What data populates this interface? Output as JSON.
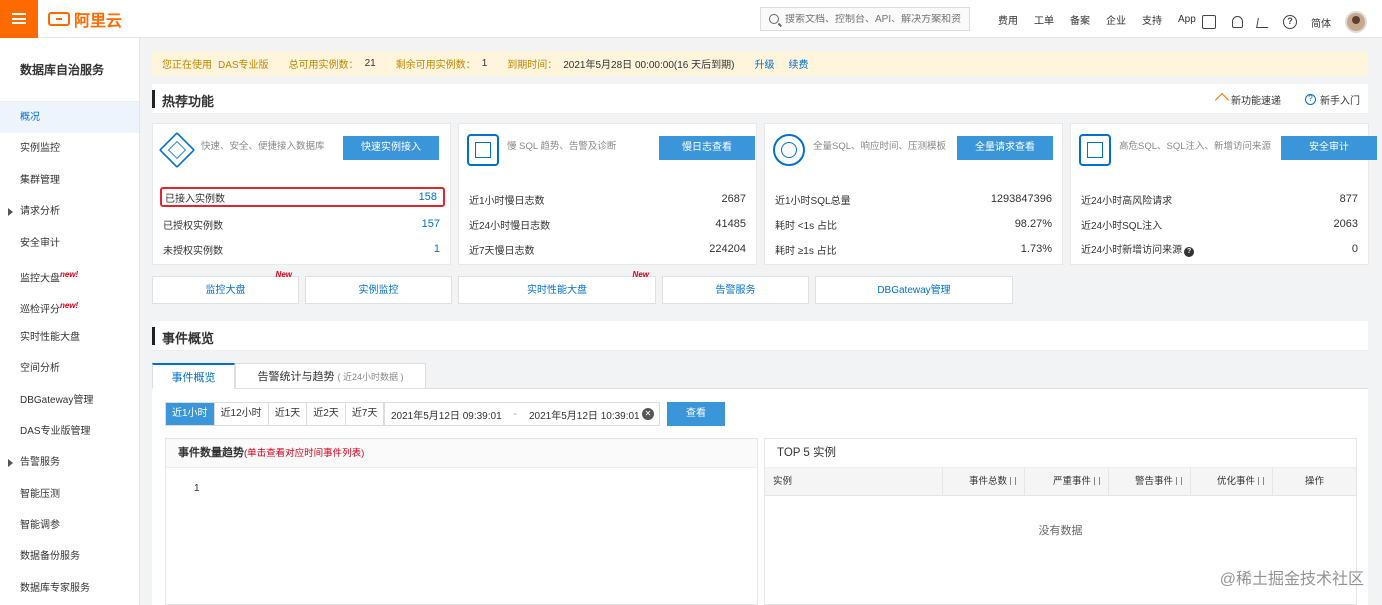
{
  "topbar": {
    "logo_text": "阿里云",
    "search_placeholder": "搜索文档、控制台、API、解决方案和资",
    "nav": [
      "费用",
      "工单",
      "备案",
      "企业",
      "支持",
      "App"
    ],
    "lang": "简体"
  },
  "sidebar": {
    "title": "数据库自治服务",
    "items": [
      {
        "label": "概况",
        "active": true
      },
      {
        "label": "实例监控"
      },
      {
        "label": "集群管理"
      },
      {
        "label": "请求分析",
        "caret": true
      },
      {
        "label": "安全审计"
      },
      {
        "label": "监控大盘",
        "new": "new!"
      },
      {
        "label": "巡检评分",
        "new": "new!"
      },
      {
        "label": "实时性能大盘"
      },
      {
        "label": "空间分析"
      },
      {
        "label": "DBGateway管理"
      },
      {
        "label": "DAS专业版管理"
      },
      {
        "label": "告警服务",
        "caret": true
      },
      {
        "label": "智能压测"
      },
      {
        "label": "智能调参"
      },
      {
        "label": "数据备份服务"
      },
      {
        "label": "数据库专家服务"
      }
    ]
  },
  "banner": {
    "using_label": "您正在使用",
    "using_value": "DAS专业版",
    "total_label": "总可用实例数：",
    "total_value": "21",
    "remain_label": "剩余可用实例数：",
    "remain_value": "1",
    "expire_label": "到期时间：",
    "expire_value": "2021年5月28日 00:00:00(16 天后到期)",
    "upgrade": "升级",
    "renew": "续费"
  },
  "hot": {
    "title": "热荐功能",
    "link_fast": "新功能速递",
    "link_guide": "新手入门"
  },
  "cards": [
    {
      "desc": "快速、安全、便捷接入数据库",
      "button": "快速实例接入",
      "rows": [
        {
          "label": "已接入实例数",
          "value": "158",
          "blue": true,
          "highlight": true
        },
        {
          "label": "已授权实例数",
          "value": "157",
          "blue": true
        },
        {
          "label": "未授权实例数",
          "value": "1",
          "blue": true
        }
      ]
    },
    {
      "desc": "慢 SQL 趋势、告警及诊断",
      "button": "慢日志查看",
      "rows": [
        {
          "label": "近1小时慢日志数",
          "value": "2687"
        },
        {
          "label": "近24小时慢日志数",
          "value": "41485"
        },
        {
          "label": "近7天慢日志数",
          "value": "224204"
        }
      ]
    },
    {
      "desc": "全量SQL、响应时间、压测模板",
      "button": "全量请求查看",
      "rows": [
        {
          "label": "近1小时SQL总量",
          "value": "1293847396"
        },
        {
          "label": "耗时 <1s 占比",
          "value": "98.27%"
        },
        {
          "label": "耗时 ≥1s 占比",
          "value": "1.73%"
        }
      ]
    },
    {
      "desc": "高危SQL、SQL注入、新增访问来源",
      "button": "安全审计",
      "rows": [
        {
          "label": "近24小时高风险请求",
          "value": "877"
        },
        {
          "label": "近24小时SQL注入",
          "value": "2063"
        },
        {
          "label": "近24小时新增访问来源",
          "value": "0",
          "help": true
        }
      ]
    }
  ],
  "quick_tabs": [
    {
      "label": "监控大盘",
      "new": "New"
    },
    {
      "label": "实例监控"
    },
    {
      "label": "实时性能大盘",
      "new": "New"
    },
    {
      "label": "告警服务"
    },
    {
      "label": "DBGateway管理"
    }
  ],
  "events": {
    "title": "事件概览",
    "tab_overview": "事件概览",
    "tab_alert": "告警统计与趋势",
    "tab_alert_note": "( 近24小时数据 )",
    "ranges": [
      "近1小时",
      "近12小时",
      "近1天",
      "近2天",
      "近7天"
    ],
    "date_start": "2021年5月12日 09:39:01",
    "date_sep": "-",
    "date_end": "2021年5月12日 10:39:01",
    "view_button": "查看",
    "trend_title": "事件数量趋势",
    "trend_hint": "(单击查看对应时间事件列表)",
    "trend_axis_value": "1",
    "top5_title": "TOP 5 实例",
    "columns": [
      "实例",
      "事件总数",
      "严重事件",
      "警告事件",
      "优化事件",
      "操作"
    ],
    "empty": "没有数据"
  },
  "watermark": "@稀土掘金技术社区"
}
